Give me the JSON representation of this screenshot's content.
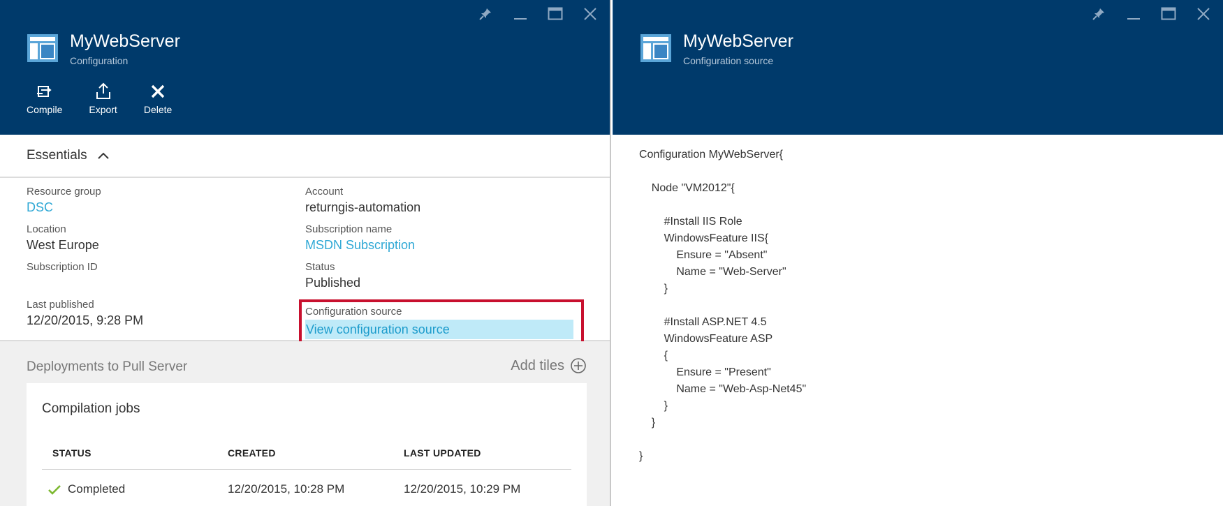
{
  "left_blade": {
    "title": "MyWebServer",
    "subtitle": "Configuration",
    "commands": [
      {
        "label": "Compile",
        "icon": "compile-icon"
      },
      {
        "label": "Export",
        "icon": "export-icon"
      },
      {
        "label": "Delete",
        "icon": "delete-icon"
      }
    ],
    "essentials": {
      "title": "Essentials",
      "resource_group_label": "Resource group",
      "resource_group_value": "DSC",
      "location_label": "Location",
      "location_value": "West Europe",
      "subscription_id_label": "Subscription ID",
      "last_published_label": "Last published",
      "last_published_value": "12/20/2015, 9:28 PM",
      "account_label": "Account",
      "account_value": "returngis-automation",
      "subscription_name_label": "Subscription name",
      "subscription_name_value": "MSDN Subscription",
      "status_label": "Status",
      "status_value": "Published",
      "config_source_label": "Configuration source",
      "config_source_link": "View configuration source"
    },
    "deployments": {
      "title": "Deployments to Pull Server",
      "add_tiles_label": "Add tiles",
      "tile_title": "Compilation jobs",
      "columns": [
        "STATUS",
        "CREATED",
        "LAST UPDATED"
      ],
      "rows": [
        {
          "status": "Completed",
          "created": "12/20/2015, 10:28 PM",
          "last_updated": "12/20/2015, 10:29 PM"
        }
      ]
    }
  },
  "right_blade": {
    "title": "MyWebServer",
    "subtitle": "Configuration source",
    "code_lines": [
      "Configuration MyWebServer{",
      "",
      "    Node \"VM2012\"{",
      "",
      "        #Install IIS Role",
      "        WindowsFeature IIS{",
      "            Ensure = \"Absent\"",
      "            Name = \"Web-Server\"",
      "        }",
      "",
      "        #Install ASP.NET 4.5",
      "        WindowsFeature ASP",
      "        {",
      "            Ensure = \"Present\"",
      "            Name = \"Web-Asp-Net45\"",
      "        }",
      "    }",
      "",
      "}"
    ]
  },
  "colors": {
    "header_bg": "#003a6b",
    "link": "#2fa8d5",
    "highlight_border": "#c8102e",
    "highlight_fill": "#bfeaf8",
    "success": "#7cb82f"
  }
}
